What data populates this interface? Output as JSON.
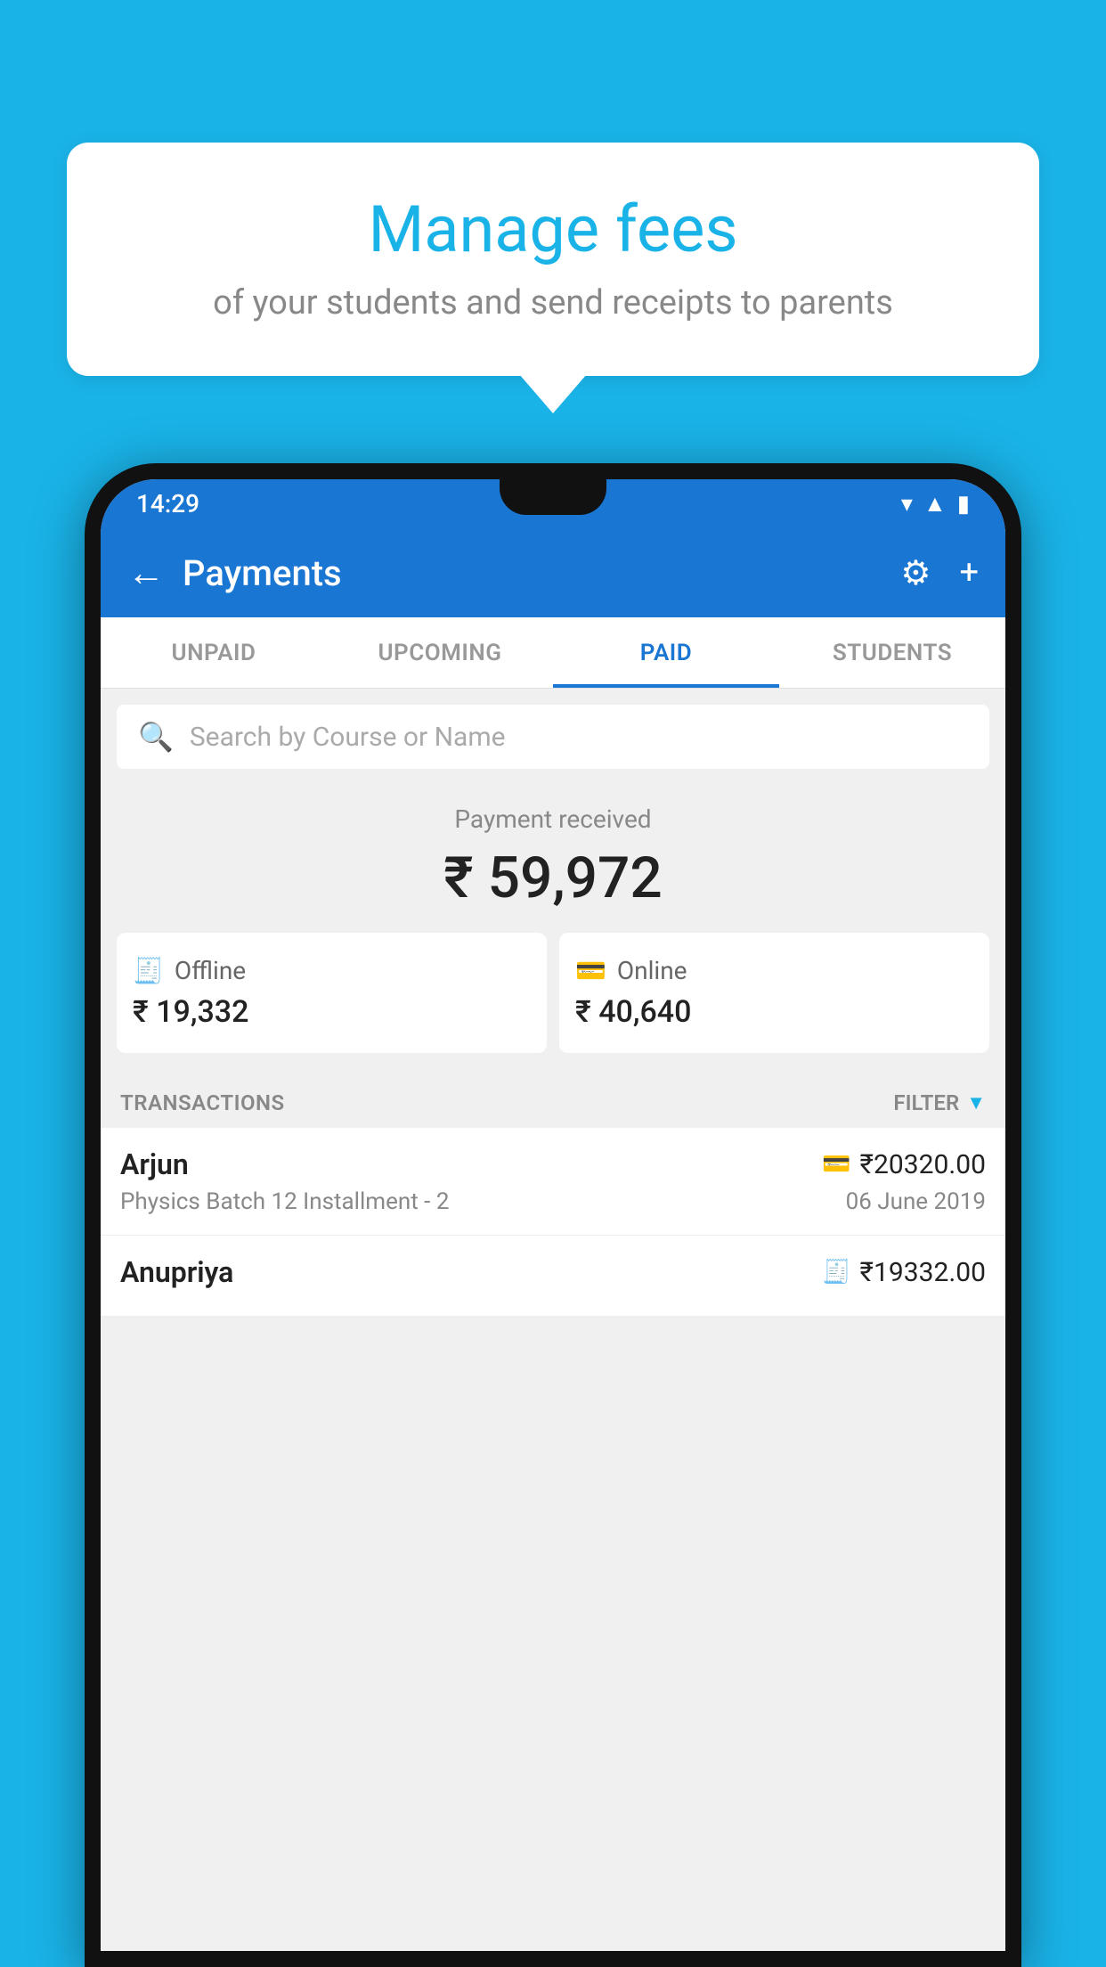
{
  "background": {
    "color": "#1ab3e8"
  },
  "speech_bubble": {
    "title": "Manage fees",
    "subtitle": "of your students and send receipts to parents"
  },
  "status_bar": {
    "time": "14:29",
    "icons": [
      "▾",
      "▲",
      "▮"
    ]
  },
  "app_bar": {
    "title": "Payments",
    "back_icon": "←",
    "settings_icon": "⚙",
    "add_icon": "+"
  },
  "tabs": [
    {
      "label": "UNPAID",
      "active": false
    },
    {
      "label": "UPCOMING",
      "active": false
    },
    {
      "label": "PAID",
      "active": true
    },
    {
      "label": "STUDENTS",
      "active": false
    }
  ],
  "search": {
    "placeholder": "Search by Course or Name"
  },
  "payment_summary": {
    "label": "Payment received",
    "total": "₹ 59,972",
    "offline_label": "Offline",
    "offline_amount": "₹ 19,332",
    "online_label": "Online",
    "online_amount": "₹ 40,640"
  },
  "transactions": {
    "label": "TRANSACTIONS",
    "filter_label": "FILTER",
    "rows": [
      {
        "name": "Arjun",
        "course": "Physics Batch 12 Installment - 2",
        "amount": "₹20320.00",
        "date": "06 June 2019",
        "payment_type": "online"
      },
      {
        "name": "Anupriya",
        "course": "",
        "amount": "₹19332.00",
        "date": "",
        "payment_type": "offline"
      }
    ]
  }
}
